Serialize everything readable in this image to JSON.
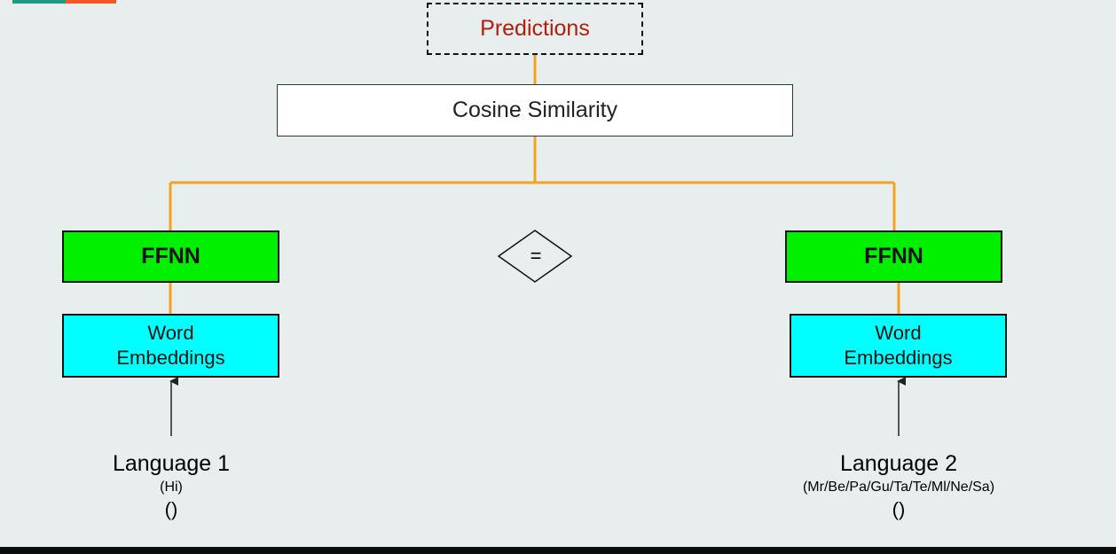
{
  "colors": {
    "connector": "#f5a21e",
    "ffnn_fill": "#00f000",
    "embedding_fill": "#00ffff",
    "predictions_text": "#b31e0c",
    "background": "#e8eded"
  },
  "diagram": {
    "predictions": "Predictions",
    "similarity": "Cosine Similarity",
    "equals_symbol": "=",
    "left": {
      "model": "FFNN",
      "embeddings_line1": "Word",
      "embeddings_line2": "Embeddings",
      "language": "Language 1",
      "language_code": "(Hi)",
      "parens": "()"
    },
    "right": {
      "model": "FFNN",
      "embeddings_line1": "Word",
      "embeddings_line2": "Embeddings",
      "language": "Language 2",
      "language_code": "(Mr/Be/Pa/Gu/Ta/Te/Ml/Ne/Sa)",
      "parens": "()"
    }
  }
}
